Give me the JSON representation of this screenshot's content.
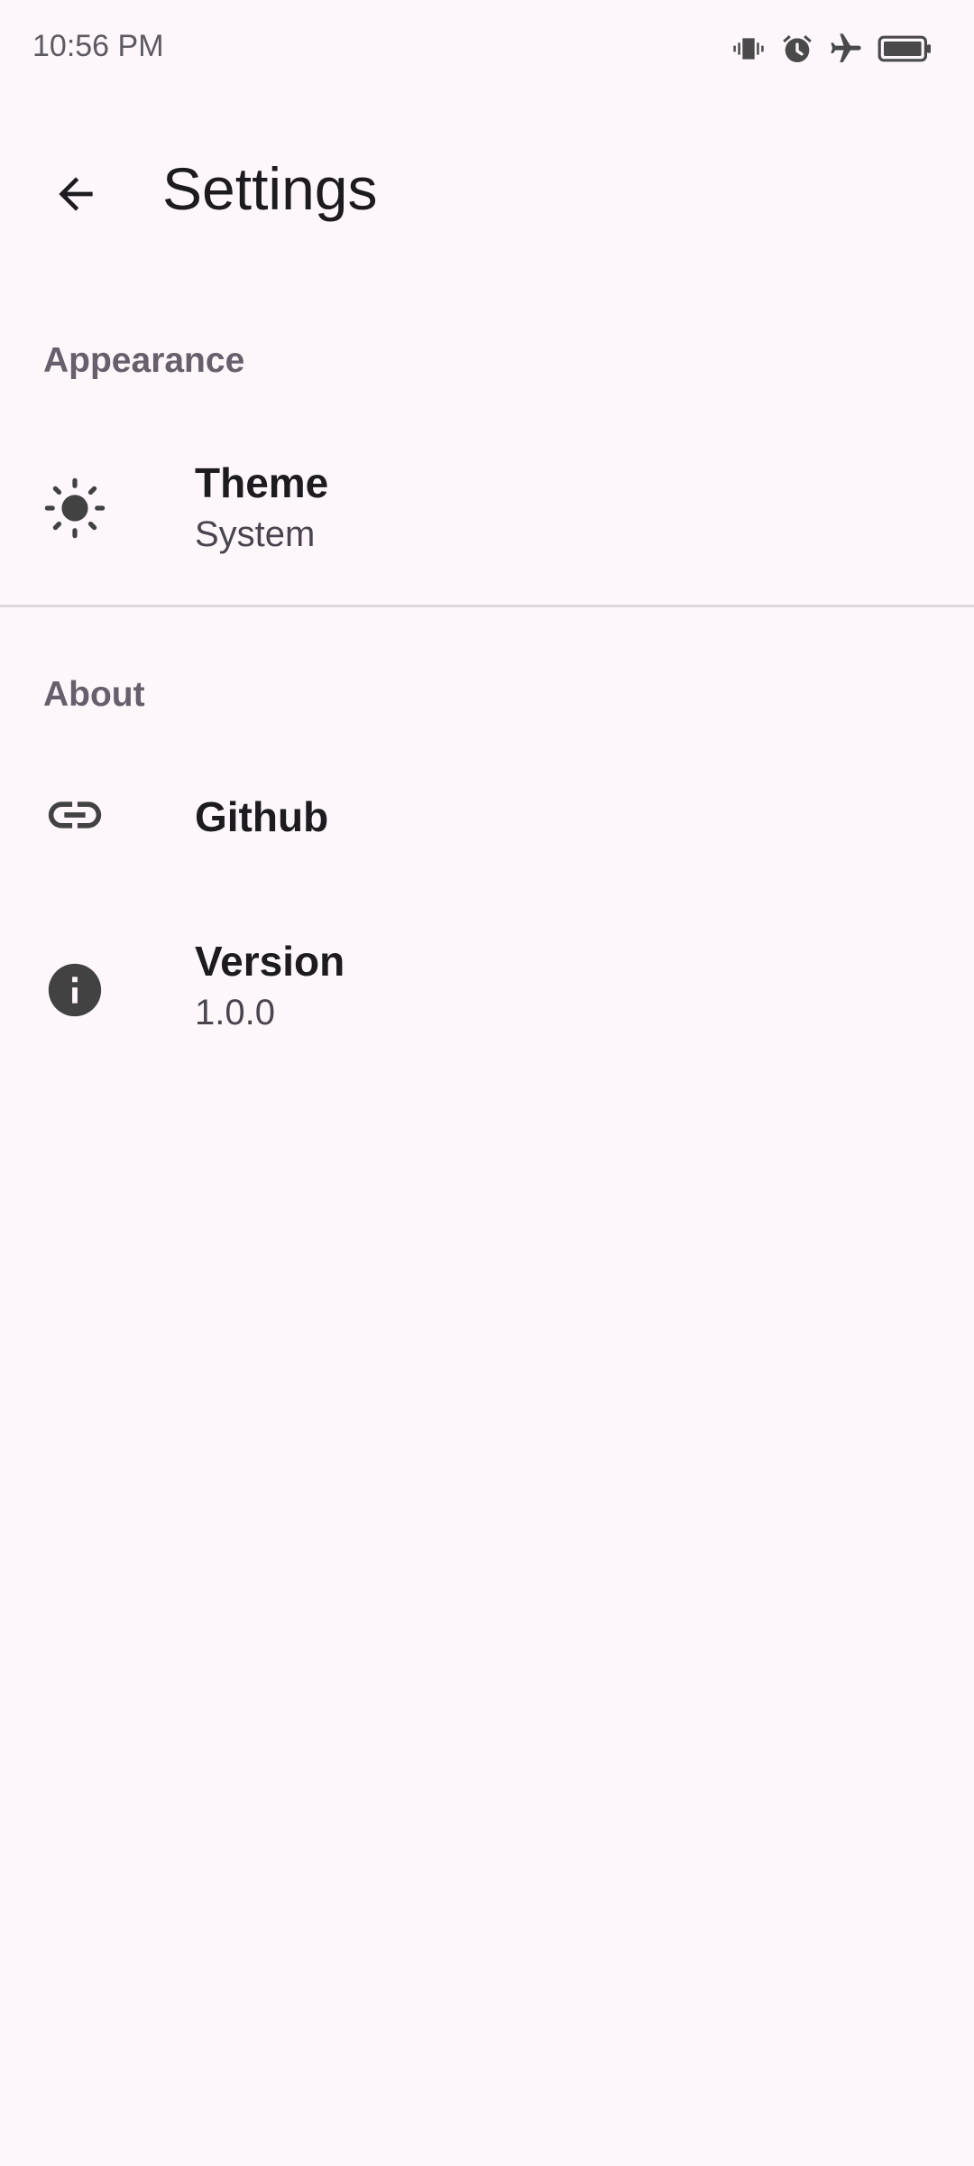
{
  "status_bar": {
    "time": "10:56 PM",
    "icons": [
      "vibrate-icon",
      "alarm-icon",
      "airplane-icon",
      "battery-icon"
    ]
  },
  "app_bar": {
    "back_icon": "arrow-back-icon",
    "title": "Settings"
  },
  "sections": {
    "appearance": {
      "header": "Appearance",
      "theme": {
        "icon": "brightness-icon",
        "title": "Theme",
        "value": "System"
      }
    },
    "about": {
      "header": "About",
      "github": {
        "icon": "link-icon",
        "title": "Github"
      },
      "version": {
        "icon": "info-icon",
        "title": "Version",
        "value": "1.0.0"
      }
    }
  },
  "colors": {
    "background": "#fdf7fc",
    "section_header": "#65606b",
    "icon": "#424242",
    "divider": "#dcd8de"
  }
}
